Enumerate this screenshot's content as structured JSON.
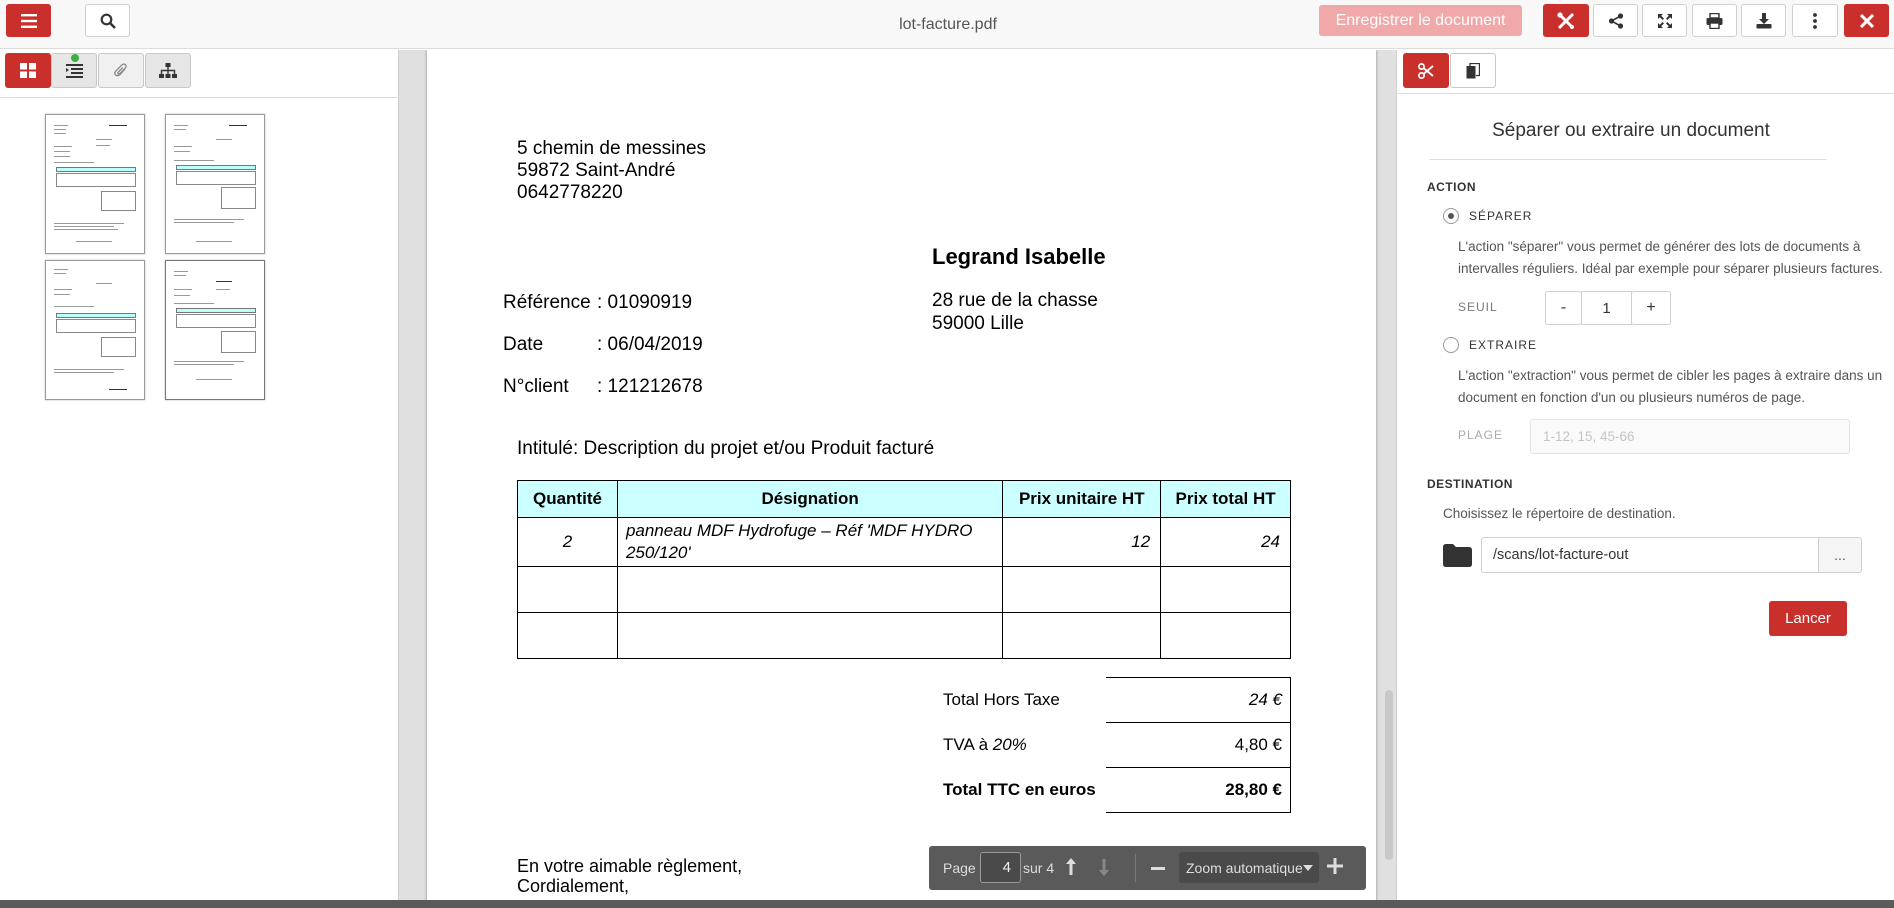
{
  "topbar": {
    "doc_title": "lot-facture.pdf",
    "save_label": "Enregistrer le document"
  },
  "viewer": {
    "page_label": "Page",
    "page_value": "4",
    "page_total": "sur 4",
    "zoom": "Zoom automatique"
  },
  "invoice": {
    "sender_address": [
      "5 chemin de messines",
      "59872 Saint-André",
      "0642778220"
    ],
    "client_name": "Legrand Isabelle",
    "client_address": [
      "28 rue de la chasse",
      "59000 Lille"
    ],
    "reference_label": "Référence",
    "reference_value": ": 01090919",
    "date_label": "Date",
    "date_value": ": 06/04/2019",
    "client_label": "N°client",
    "client_value": ": 121212678",
    "intitule": "Intitulé: Description du projet et/ou Produit facturé",
    "table_headers": [
      "Quantité",
      "Désignation",
      "Prix unitaire HT",
      "Prix total HT"
    ],
    "rows": [
      {
        "qty": "2",
        "designation": "panneau MDF Hydrofuge – Réf 'MDF HYDRO 250/120'",
        "unit": "12",
        "total": "24"
      }
    ],
    "totals": [
      {
        "label": "Total Hors Taxe",
        "value": "24 €"
      },
      {
        "label_prefix": "TVA à ",
        "label_rate": "20%",
        "value": "4,80 €"
      },
      {
        "label": "Total TTC en euros",
        "value": "28,80 €"
      }
    ],
    "closing": [
      "En votre aimable règlement,",
      "Cordialement,"
    ]
  },
  "rightpanel": {
    "title": "Séparer ou extraire un document",
    "action_section": "ACTION",
    "split_label": "SÉPARER",
    "split_desc": "L'action \"séparer\" vous permet de générer des lots de documents à intervalles réguliers. Idéal par exemple pour séparer plusieurs factures.",
    "threshold_label": "SEUIL",
    "threshold_minus": "-",
    "threshold_value": "1",
    "threshold_plus": "+",
    "extract_label": "EXTRAIRE",
    "extract_desc": "L'action \"extraction\" vous permet de cibler les pages à extraire dans un document en fonction d'un ou plusieurs numéros de page.",
    "range_label": "PLAGE",
    "range_placeholder": "1-12, 15, 45-66",
    "destination_section": "DESTINATION",
    "destination_desc": "Choisissez le répertoire de destination.",
    "destination_path": "/scans/lot-facture-out",
    "browse_label": "...",
    "launch_label": "Lancer"
  },
  "colors": {
    "accent": "#c9302c",
    "table_header": "#ccffff",
    "status_dot": "#3cb043"
  }
}
